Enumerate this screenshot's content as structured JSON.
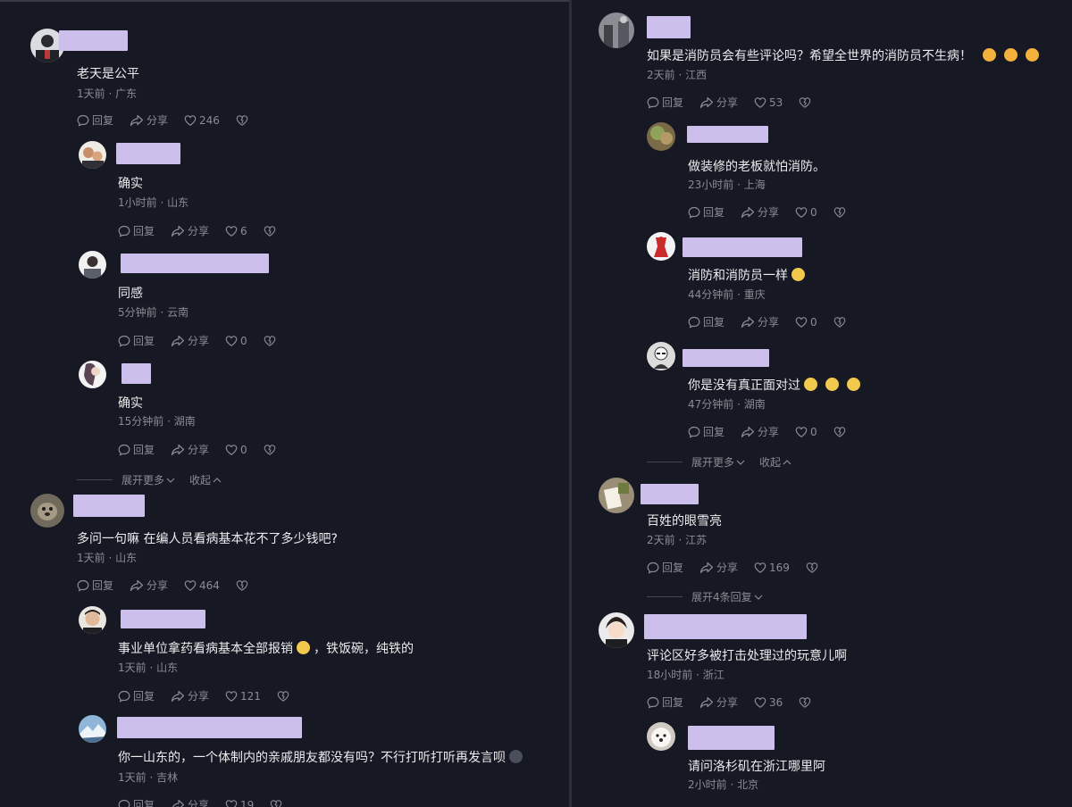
{
  "left": {
    "c1": {
      "text": "老天是公平",
      "time": "1天前",
      "loc": "广东",
      "reply": "回复",
      "share": "分享",
      "likes": "246"
    },
    "c1r1": {
      "text": "确实",
      "time": "1小时前",
      "loc": "山东",
      "reply": "回复",
      "share": "分享",
      "likes": "6"
    },
    "c1r2": {
      "text": "同感",
      "time": "5分钟前",
      "loc": "云南",
      "reply": "回复",
      "share": "分享",
      "likes": "0"
    },
    "c1r3": {
      "text": "确实",
      "time": "15分钟前",
      "loc": "湖南",
      "reply": "回复",
      "share": "分享",
      "likes": "0"
    },
    "expand1": {
      "more": "展开更多",
      "collapse": "收起"
    },
    "c2": {
      "text": "多问一句嘛 在编人员看病基本花不了多少钱吧?",
      "time": "1天前",
      "loc": "山东",
      "reply": "回复",
      "share": "分享",
      "likes": "464"
    },
    "c2r1": {
      "text": "事业单位拿药看病基本全部报销",
      "text2": "，铁饭碗，纯铁的",
      "time": "1天前",
      "loc": "山东",
      "reply": "回复",
      "share": "分享",
      "likes": "121"
    },
    "c2r2": {
      "text": "你一山东的，一个体制内的亲戚朋友都没有吗？不行打听打听再发言呗",
      "time": "1天前",
      "loc": "吉林",
      "reply": "回复",
      "share": "分享",
      "likes": "19"
    }
  },
  "right": {
    "c1": {
      "text": "如果是消防员会有些评论吗？希望全世界的消防员不生病！",
      "time": "2天前",
      "loc": "江西",
      "reply": "回复",
      "share": "分享",
      "likes": "53"
    },
    "c1r1": {
      "text": "做装修的老板就怕消防。",
      "time": "23小时前",
      "loc": "上海",
      "reply": "回复",
      "share": "分享",
      "likes": "0"
    },
    "c1r2": {
      "text": "消防和消防员一样",
      "time": "44分钟前",
      "loc": "重庆",
      "reply": "回复",
      "share": "分享",
      "likes": "0"
    },
    "c1r3": {
      "text": "你是没有真正面对过",
      "time": "47分钟前",
      "loc": "湖南",
      "reply": "回复",
      "share": "分享",
      "likes": "0"
    },
    "expand1": {
      "more": "展开更多",
      "collapse": "收起"
    },
    "c2": {
      "text": "百姓的眼雪亮",
      "time": "2天前",
      "loc": "江苏",
      "reply": "回复",
      "share": "分享",
      "likes": "169"
    },
    "expand2": {
      "more": "展开4条回复"
    },
    "c3": {
      "text": "评论区好多被打击处理过的玩意儿啊",
      "time": "18小时前",
      "loc": "浙江",
      "reply": "回复",
      "share": "分享",
      "likes": "36"
    },
    "c3r1": {
      "text": "请问洛杉矶在浙江哪里阿",
      "time": "2小时前",
      "loc": "北京"
    }
  },
  "colors": {
    "background": "#161823",
    "name_redaction": "#cdbfec",
    "meta": "#8a8b93",
    "text": "#ececee"
  },
  "icons": [
    "comment-icon",
    "share-icon",
    "heart-icon",
    "dislike-icon",
    "chevron-down-icon",
    "chevron-up-icon"
  ]
}
